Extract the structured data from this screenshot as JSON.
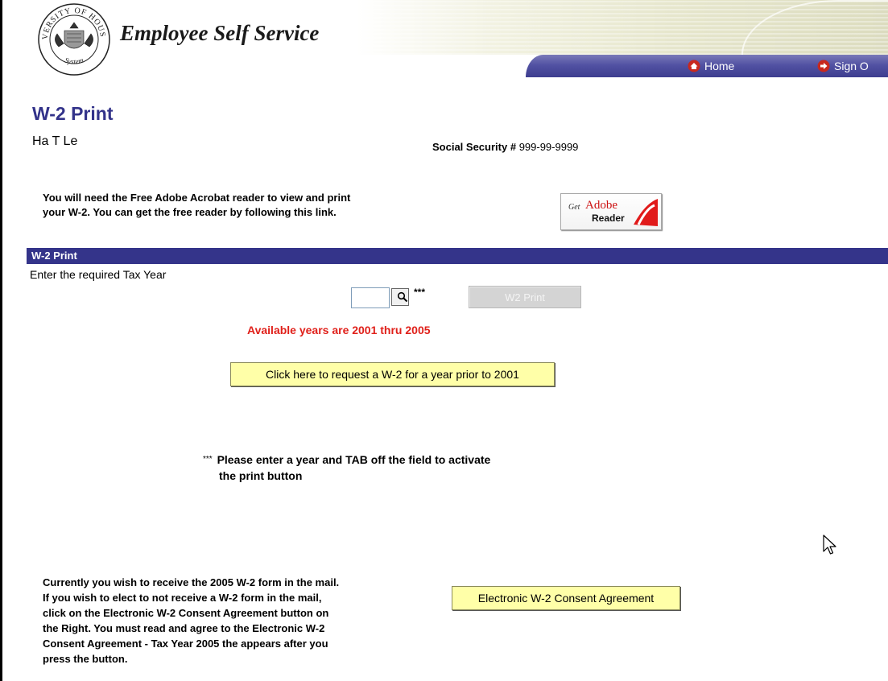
{
  "header": {
    "seal_text_top": "UNIVERSITY OF HOUSTON",
    "seal_text_bottom": "System",
    "app_title": "Employee Self Service",
    "nav": [
      {
        "label": "Home",
        "icon": "home-icon"
      },
      {
        "label": "Sign O",
        "icon": "arrow-right-icon"
      }
    ]
  },
  "page": {
    "title": "W-2 Print",
    "employee_name": "Ha T Le",
    "ssn_label": "Social Security #",
    "ssn_value": "999-99-9999"
  },
  "adobe": {
    "message_line1": "You will need the Free Adobe Acrobat reader to view and print",
    "message_line2": "your W-2. You can get the free reader by following this link.",
    "badge_get": "Get",
    "badge_adobe": "Adobe",
    "badge_reader": "Reader"
  },
  "section": {
    "header": "W-2 Print",
    "tax_year_label": "Enter the required Tax Year",
    "tax_year_value": "",
    "asterisks": "***",
    "print_button_label": "W2 Print",
    "available_years": "Available years are 2001 thru 2005",
    "prior_year_button_label": "Click here to request a W-2 for a year prior to 2001",
    "note_stars": "***",
    "note_line1": "Please enter a year and TAB off the field to activate",
    "note_line2": "the print button"
  },
  "consent": {
    "lines": [
      "Currently you wish to receive the 2005 W-2 form in the mail.",
      "If you wish to elect to not receive a W-2 form in the mail,",
      "click on the Electronic W-2 Consent Agreement button on",
      "the Right. You must read and agree to the Electronic W-2",
      "Consent Agreement - Tax Year 2005 the appears after you",
      "press the button."
    ],
    "button_label": "Electronic W-2 Consent Agreement"
  },
  "colors": {
    "brand_blue": "#34348a",
    "title_blue": "#33338a",
    "alert_red": "#e0201a",
    "button_yellow": "#ffffa8"
  }
}
